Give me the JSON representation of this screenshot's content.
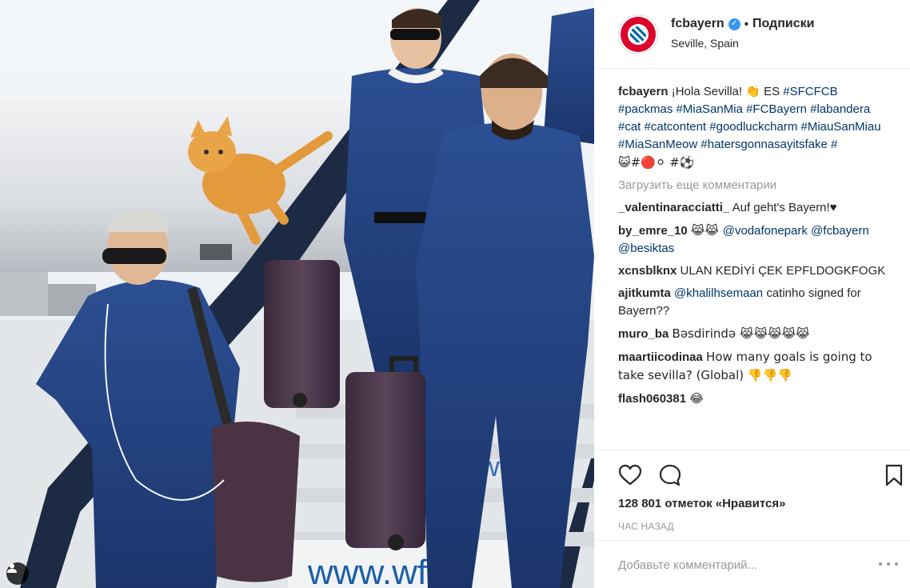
{
  "post": {
    "username": "fcbayern",
    "verified_icon": "verified-badge-icon",
    "follow_label": "Подписки",
    "location": "Seville, Spain",
    "caption": {
      "text_before": "¡Hola Sevilla! 👏 ES",
      "line1_tag": "#SFCFCB",
      "tags": [
        "#packmas",
        "#MiaSanMia",
        "#FCBayern",
        "#labandera",
        "#cat",
        "#catcontent",
        "#goodluckcharm",
        "#MiauSanMiau",
        "#MiaSanMeow",
        "#hatersgonnasayitsfake",
        "#"
      ],
      "emoji_line": "😺#🔴⚪ #⚽"
    },
    "load_more_label": "Загрузить еще комментарии",
    "comments": [
      {
        "user": "_valentinaracciatti_",
        "text": "Auf geht's Bayern!♥"
      },
      {
        "user": "by_emre_10",
        "text": "😹😹 ",
        "mentions": [
          "@vodafonepark",
          "@fcbayern",
          "@besiktas"
        ]
      },
      {
        "user": "xcnsblknx",
        "text": "ULAN KEDİYİ ÇEK EPFLDOGKFOGK"
      },
      {
        "user": "ajitkumta",
        "mention": "@khalilhsemaan",
        "text": " catinho signed for Bayern??"
      },
      {
        "user": "muro_ba",
        "text": "Bəsdirində 😹😹😹😹😹"
      },
      {
        "user": "maartiicodinaa",
        "text": "How many goals is going to take sevilla? (Global) 👎👎👎"
      },
      {
        "user": "flash060381",
        "text": "😂"
      }
    ],
    "likes_text": "128 801 отметок «Нравится»",
    "time_text": "ЧАС НАЗАД",
    "add_comment_placeholder": "Добавьте комментарий...",
    "photo_text": {
      "sign_bottom": "www.wfs",
      "sign_middle": "wfs ro"
    }
  },
  "icons": {
    "like": "heart-icon",
    "comment": "comment-bubble-icon",
    "save": "bookmark-icon",
    "more": "more-options-icon",
    "user_tags": "user-tag-icon"
  },
  "colors": {
    "link": "#003569",
    "muted": "#999999",
    "verified": "#3897f0",
    "bayern_red": "#dc052d"
  }
}
